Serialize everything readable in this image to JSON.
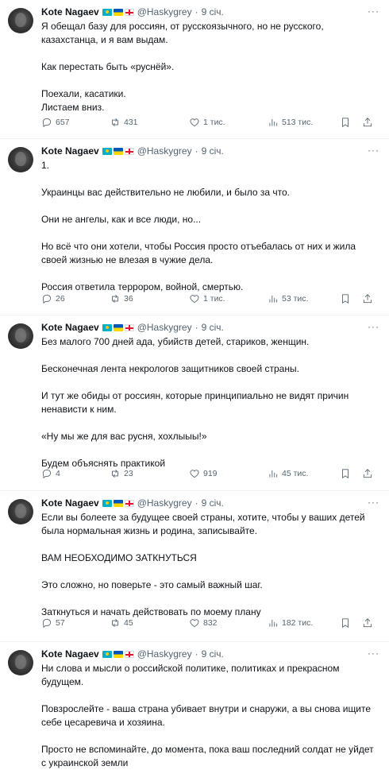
{
  "tweets": [
    {
      "author": "Kote Nagaev",
      "handle": "@Haskygrey",
      "time": "9 січ.",
      "paragraphs": [
        "Я обещал базу для россиян, от русскоязычного, но не русского, казахстанца, и я вам выдам.",
        "Как перестать быть «руснёй».",
        "Поехали, касатики.\nЛистаем вниз."
      ],
      "replies": "657",
      "retweets": "431",
      "likes": "1 тис.",
      "views": "513 тис."
    },
    {
      "author": "Kote Nagaev",
      "handle": "@Haskygrey",
      "time": "9 січ.",
      "paragraphs": [
        "1.",
        "Украинцы вас действительно не любили, и было за что.",
        "Они не ангелы, как и все люди, но...",
        "Но всё что они хотели, чтобы Россия просто отъебалась от них и жила своей жизнью не влезая в чужие дела.",
        "Россия ответила террором, войной, смертью."
      ],
      "replies": "26",
      "retweets": "36",
      "likes": "1 тис.",
      "views": "53 тис."
    },
    {
      "author": "Kote Nagaev",
      "handle": "@Haskygrey",
      "time": "9 січ.",
      "paragraphs": [
        "Без малого 700 дней ада, убийств детей, стариков, женщин.",
        "Бесконечная лента некрологов защитников своей страны.",
        "И тут же обиды от россиян, которые принципиально не видят причин ненависти к ним.",
        "«Ну мы же для вас русня, хохлыыы!»",
        "Будем объяснять практикой"
      ],
      "replies": "4",
      "retweets": "23",
      "likes": "919",
      "views": "45 тис."
    },
    {
      "author": "Kote Nagaev",
      "handle": "@Haskygrey",
      "time": "9 січ.",
      "paragraphs": [
        "Если вы болеете за будущее своей страны, хотите, чтобы у ваших детей была нормальная жизнь и родина, записывайте.",
        "ВАМ НЕОБХОДИМО ЗАТКНУТЬСЯ",
        "Это сложно, но поверьте - это самый важный шаг.",
        "Заткнуться и начать действовать по моему плану"
      ],
      "replies": "57",
      "retweets": "45",
      "likes": "832",
      "views": "182 тис."
    },
    {
      "author": "Kote Nagaev",
      "handle": "@Haskygrey",
      "time": "9 січ.",
      "paragraphs": [
        "Ни слова и мысли о российской политике, политиках и прекрасном будущем.",
        "Повзрослейте - ваша страна убивает внутри и снаружи, а вы снова ищите себе цесаревича и хозяина.",
        "Просто не вспоминайте, до момента, пока ваш последний солдат не уйдет с украинской земли"
      ],
      "replies": "",
      "retweets": "",
      "likes": "",
      "views": ""
    }
  ],
  "icons": {
    "reply": "reply-icon",
    "retweet": "retweet-icon",
    "like": "heart-icon",
    "views": "views-icon",
    "bookmark": "bookmark-icon",
    "share": "share-icon",
    "more": "more-icon"
  }
}
